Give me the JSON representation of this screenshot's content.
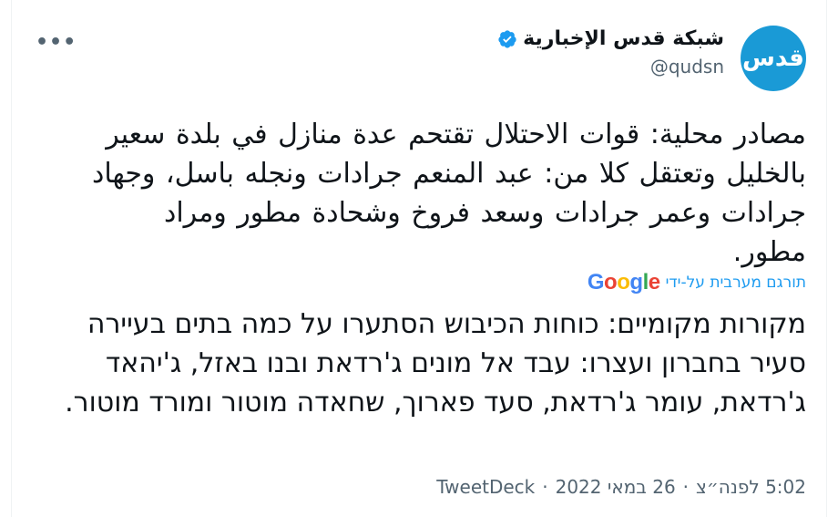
{
  "author": {
    "avatar_text": "قدس",
    "display_name": "شبكة قدس الإخبارية",
    "handle": "@qudsn",
    "verified": true
  },
  "more_menu_label": "•••",
  "tweet": {
    "original_text": "مصادر محلية: قوات الاحتلال تقتحم عدة منازل في بلدة سعير بالخليل وتعتقل كلا من: عبد المنعم جرادات ونجله باسل، وجهاد جرادات وعمر جرادات وسعد فروخ وشحادة مطور ومراد مطور.",
    "translated_by_label": "תורגם מערבית על-ידי",
    "translation_provider": [
      "G",
      "o",
      "o",
      "g",
      "l",
      "e"
    ],
    "translated_text": "מקורות מקומיים: כוחות הכיבוש הסתערו על כמה בתים בעיירה סעיר בחברון ועצרו: עבד אל מונים ג'רדאת ובנו באזל, ג'יהאד ג'רדאת, עומר ג'רדאת, סעד פארוך, שחאדה מוטור ומורד מוטור."
  },
  "meta": {
    "time": "5:02 לפנה״צ",
    "separator": "·",
    "date": "26 במאי 2022",
    "source": "TweetDeck"
  },
  "colors": {
    "accent": "#1d9bf0",
    "avatar_bg": "#1a9ad6",
    "text_primary": "#0f1419",
    "text_secondary": "#536471"
  }
}
